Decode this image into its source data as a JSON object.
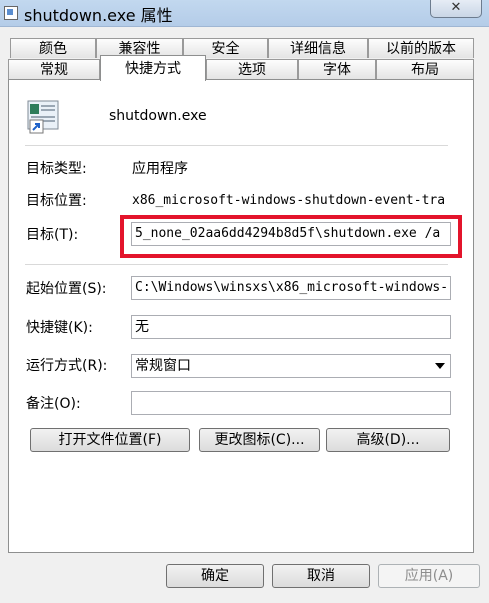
{
  "window": {
    "title": "shutdown.exe 属性",
    "close_glyph": "✕"
  },
  "tabs_row1": [
    "颜色",
    "兼容性",
    "安全",
    "详细信息",
    "以前的版本"
  ],
  "tabs_row2": [
    "常规",
    "快捷方式",
    "选项",
    "字体",
    "布局"
  ],
  "active_tab": "快捷方式",
  "file": {
    "name": "shutdown.exe",
    "icon": "shortcut-file-icon"
  },
  "target_type": {
    "label": "目标类型:",
    "value": "应用程序"
  },
  "target_location": {
    "label": "目标位置:",
    "value": "x86_microsoft-windows-shutdown-event-tra"
  },
  "target": {
    "label": "目标(T):",
    "value": "5_none_02aa6dd4294b8d5f\\shutdown.exe /a"
  },
  "start_in": {
    "label": "起始位置(S):",
    "value": "C:\\Windows\\winsxs\\x86_microsoft-windows-"
  },
  "shortcut_key": {
    "label": "快捷键(K):",
    "value": "无"
  },
  "run": {
    "label": "运行方式(R):",
    "value": "常规窗口"
  },
  "comment": {
    "label": "备注(O):",
    "value": ""
  },
  "buttons": {
    "open_location": "打开文件位置(F)",
    "change_icon": "更改图标(C)...",
    "advanced": "高级(D)..."
  },
  "footer": {
    "ok": "确定",
    "cancel": "取消",
    "apply": "应用(A)"
  },
  "colors": {
    "highlight": "#e3142b",
    "titlebar": "#c2d8ef"
  }
}
